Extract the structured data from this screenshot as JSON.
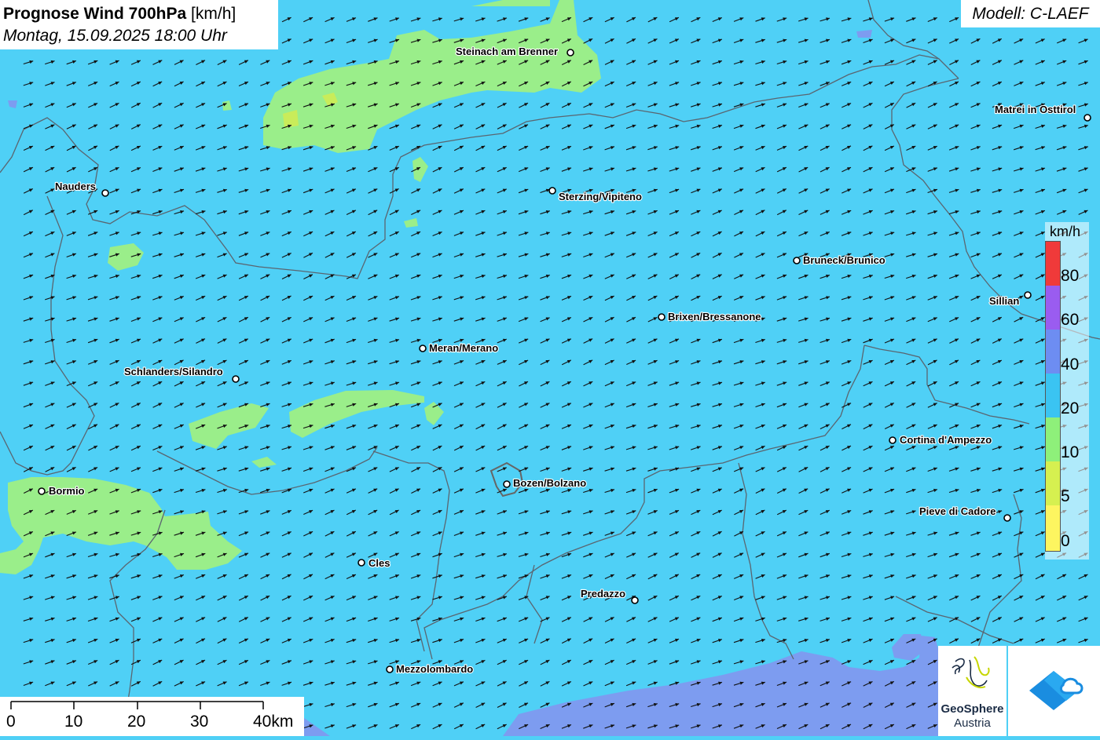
{
  "title": {
    "main": "Prognose Wind 700hPa",
    "unit": "[km/h]",
    "subtitle": "Montag, 15.09.2025 18:00 Uhr"
  },
  "model": "Modell: C-LAEF",
  "legend": {
    "unit": "km/h",
    "ticks": [
      "80",
      "60",
      "40",
      "20",
      "10",
      "5",
      "0"
    ],
    "colors": [
      "#f03a3a",
      "#9a5cf0",
      "#6d8df2",
      "#3ac4f2",
      "#8ef07a",
      "#d6f050",
      "#fdf560"
    ]
  },
  "scalebar": {
    "labels": [
      "0",
      "10",
      "20",
      "30",
      "40km"
    ]
  },
  "cities": [
    {
      "name": "Steinach am Brenner"
    },
    {
      "name": "Matrei in Osttirol"
    },
    {
      "name": "Nauders"
    },
    {
      "name": "Sterzing/Vipiteno"
    },
    {
      "name": "Bruneck/Brunico"
    },
    {
      "name": "Sillian"
    },
    {
      "name": "Brixen/Bressanone"
    },
    {
      "name": "Meran/Merano"
    },
    {
      "name": "Schlanders/Silandro"
    },
    {
      "name": "Cortina d'Ampezzo"
    },
    {
      "name": "Bozen/Bolzano"
    },
    {
      "name": "Bormio"
    },
    {
      "name": "Pieve di Cadore"
    },
    {
      "name": "Cles"
    },
    {
      "name": "Predazzo"
    },
    {
      "name": "Mezzolombardo"
    }
  ],
  "logos": {
    "geosphere_line1": "GeoSphere",
    "geosphere_line2": "Austria"
  },
  "colors": {
    "background": "#4fd0f6",
    "calm": "#9aee8a",
    "moderate": "#7d9cf0",
    "border": "#5a6570"
  }
}
